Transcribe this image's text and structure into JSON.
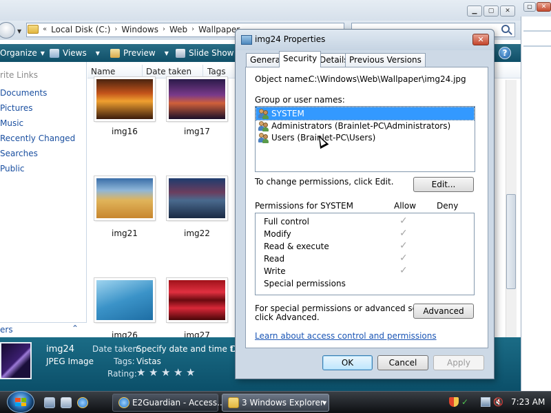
{
  "explorer": {
    "breadcrumb": [
      "Local Disk (C:)",
      "Windows",
      "Web",
      "Wallpaper"
    ],
    "toolbar": {
      "organize": "Organize",
      "views": "Views",
      "preview": "Preview",
      "slideshow": "Slide Show"
    },
    "nav": {
      "heading": "rite Links",
      "links": [
        "Documents",
        "Pictures",
        "Music",
        "Recently Changed",
        "Searches",
        "Public"
      ],
      "folders": "ers"
    },
    "columns": [
      "Name",
      "Date taken",
      "Tags"
    ],
    "thumbnails": [
      {
        "name": "img16"
      },
      {
        "name": "img17"
      },
      {
        "name": "img21"
      },
      {
        "name": "img22"
      },
      {
        "name": "img26"
      },
      {
        "name": "img27"
      }
    ],
    "details": {
      "filename": "img24",
      "filetype": "JPEG Image",
      "date_label": "Date taken:",
      "date_value": "Specify date and time t...",
      "tags_label": "Tags:",
      "tags_value": "Vistas",
      "rating_label": "Rating:",
      "rating_stars": 0,
      "cut_char": "D"
    }
  },
  "dialog": {
    "title": "img24 Properties",
    "tabs": [
      "General",
      "Security",
      "Details",
      "Previous Versions"
    ],
    "active_tab": "Security",
    "object_label": "Object name:",
    "object_value": "C:\\Windows\\Web\\Wallpaper\\img24.jpg",
    "group_label": "Group or user names:",
    "users": [
      "SYSTEM",
      "Administrators (Brainlet-PC\\Administrators)",
      "Users (Brainlet-PC\\Users)"
    ],
    "selected_user": "SYSTEM",
    "change_text": "To change permissions, click Edit.",
    "edit_button": "Edit...",
    "perms_header": "Permissions for SYSTEM",
    "allow_header": "Allow",
    "deny_header": "Deny",
    "permissions": [
      {
        "name": "Full control",
        "allow": true
      },
      {
        "name": "Modify",
        "allow": true
      },
      {
        "name": "Read & execute",
        "allow": true
      },
      {
        "name": "Read",
        "allow": true
      },
      {
        "name": "Write",
        "allow": true
      },
      {
        "name": "Special permissions",
        "allow": false
      }
    ],
    "special_line1": "For special permissions or advanced settings,",
    "special_line2": "click Advanced.",
    "advanced_button": "Advanced",
    "learn_link": "Learn about access control and permissions",
    "ok": "OK",
    "cancel": "Cancel",
    "apply": "Apply"
  },
  "taskbar": {
    "buttons": [
      "E2Guardian - Access...",
      "3 Windows Explorer"
    ],
    "clock": "7:23 AM"
  },
  "colors": {
    "cmdbar": "#1a5f7a",
    "selection": "#3399ff",
    "link": "#1a55b5"
  }
}
